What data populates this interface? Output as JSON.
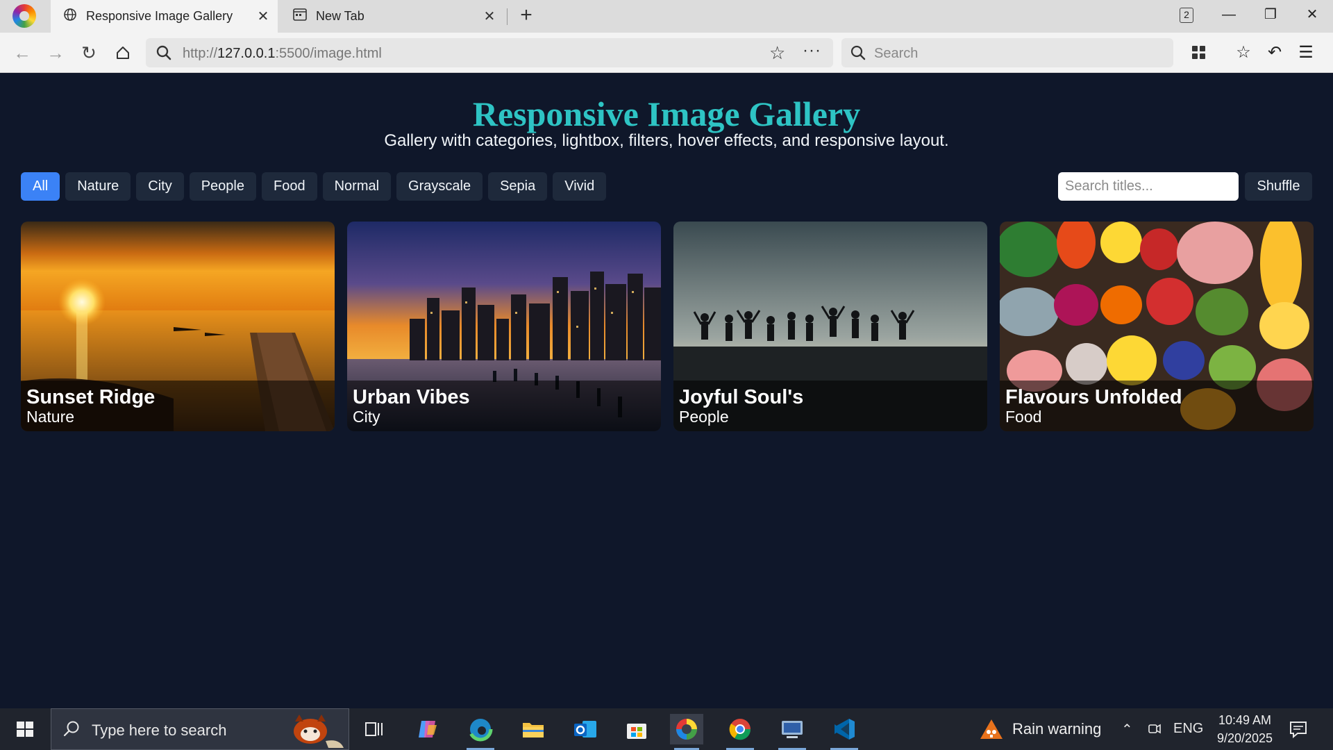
{
  "browser": {
    "tabs": [
      {
        "title": "Responsive Image Gallery",
        "icon": "globe-icon",
        "active": true
      },
      {
        "title": "New Tab",
        "icon": "new-tab-icon",
        "active": false
      }
    ],
    "tab_count": "2",
    "url_prefix": "http://",
    "url_host": "127.0.0.1",
    "url_rest": ":5500/image.html",
    "search_placeholder": "Search"
  },
  "page": {
    "title": "Responsive Image Gallery",
    "subtitle": "Gallery with categories, lightbox, filters, hover effects, and responsive layout.",
    "filters": [
      {
        "label": "All",
        "active": true
      },
      {
        "label": "Nature",
        "active": false
      },
      {
        "label": "City",
        "active": false
      },
      {
        "label": "People",
        "active": false
      },
      {
        "label": "Food",
        "active": false
      },
      {
        "label": "Normal",
        "active": false
      },
      {
        "label": "Grayscale",
        "active": false
      },
      {
        "label": "Sepia",
        "active": false
      },
      {
        "label": "Vivid",
        "active": false
      }
    ],
    "search_placeholder": "Search titles...",
    "shuffle_label": "Shuffle",
    "cards": [
      {
        "title": "Sunset Ridge",
        "category": "Nature"
      },
      {
        "title": "Urban Vibes",
        "category": "City"
      },
      {
        "title": "Joyful Soul's",
        "category": "People"
      },
      {
        "title": "Flavours Unfolded",
        "category": "Food"
      }
    ],
    "colors": {
      "background": "#0f172a",
      "title": "#2ec4c4",
      "accent": "#3b82f6",
      "chip": "#1e293b"
    }
  },
  "taskbar": {
    "search_placeholder": "Type here to search",
    "weather": "Rain warning",
    "language": "ENG",
    "time": "10:49 AM",
    "date": "9/20/2025",
    "apps": [
      "task-view-icon",
      "copilot-icon",
      "edge-icon",
      "file-explorer-icon",
      "outlook-icon",
      "store-icon",
      "browser-icon",
      "chrome-icon",
      "remote-desktop-icon",
      "vscode-icon"
    ]
  }
}
